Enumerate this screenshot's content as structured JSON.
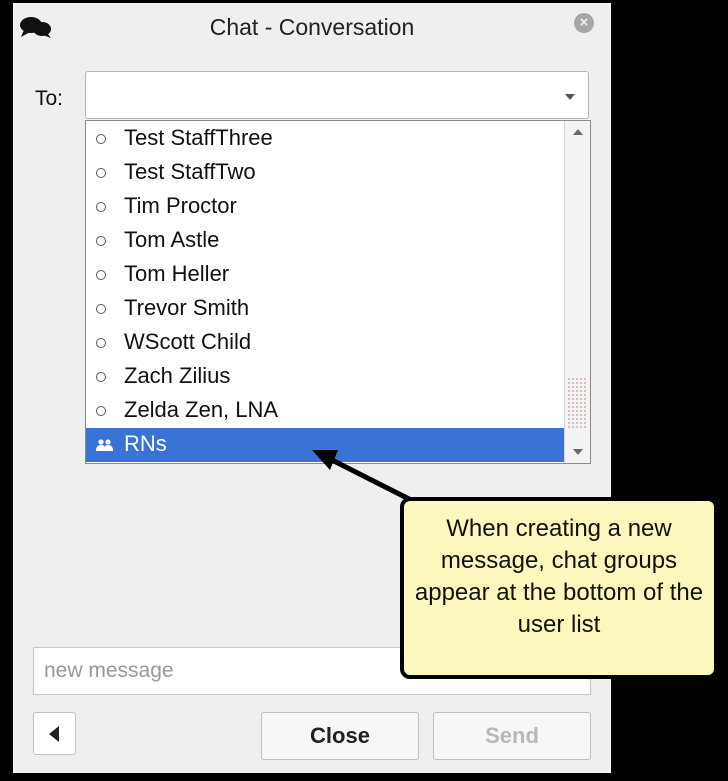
{
  "window": {
    "title": "Chat - Conversation",
    "close_glyph": "×"
  },
  "to": {
    "label": "To:",
    "value": ""
  },
  "user_list": [
    {
      "label": "Test StaffThree",
      "type": "user"
    },
    {
      "label": "Test StaffTwo",
      "type": "user"
    },
    {
      "label": "Tim Proctor",
      "type": "user"
    },
    {
      "label": "Tom Astle",
      "type": "user"
    },
    {
      "label": "Tom Heller",
      "type": "user"
    },
    {
      "label": "Trevor Smith",
      "type": "user"
    },
    {
      "label": "WScott Child",
      "type": "user"
    },
    {
      "label": "Zach Zilius",
      "type": "user"
    },
    {
      "label": "Zelda Zen, LNA",
      "type": "user"
    },
    {
      "label": "RNs",
      "type": "group",
      "selected": true
    }
  ],
  "message": {
    "placeholder": "new message"
  },
  "buttons": {
    "close_label": "Close",
    "send_label": "Send"
  },
  "callout": {
    "text": "When creating a new message, chat groups appear at the bottom of the user list"
  },
  "colors": {
    "selection": "#3a73d6",
    "callout_bg": "#fcf7bd"
  },
  "icons": {
    "window_icon": "chat-bubbles-icon",
    "group_icon": "group-icon"
  }
}
